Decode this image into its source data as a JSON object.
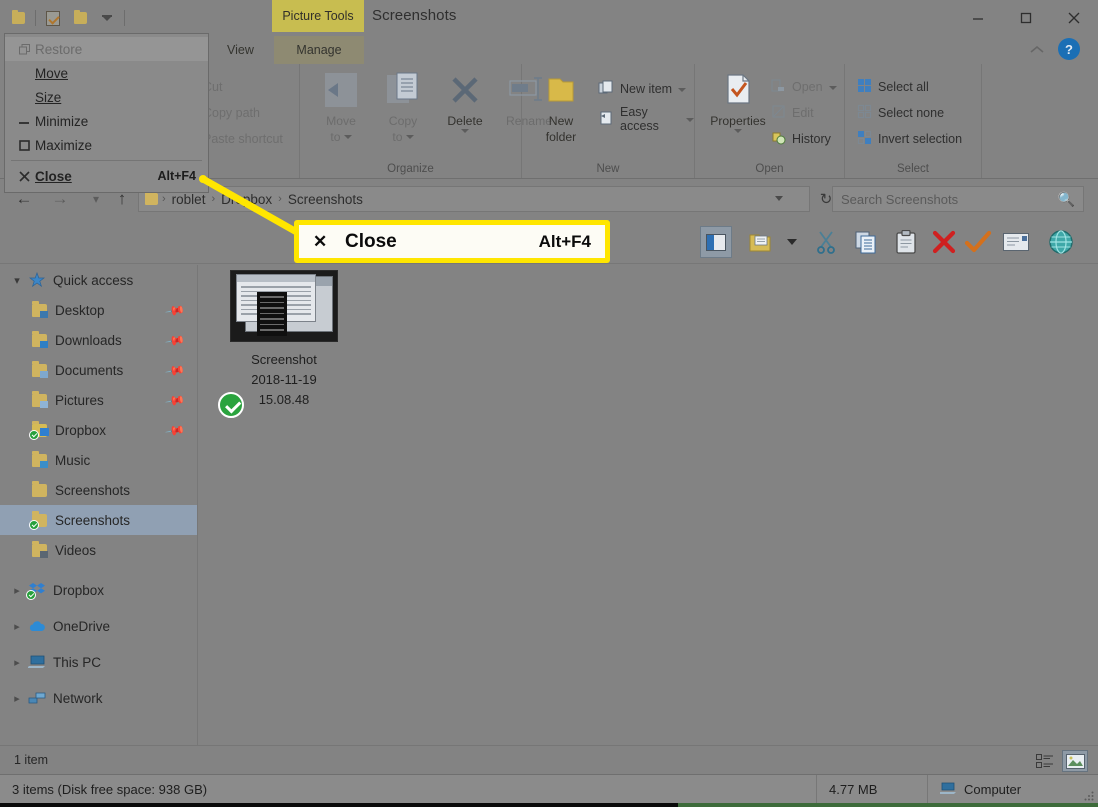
{
  "window": {
    "title": "Screenshots",
    "contextual_tab_group": "Picture Tools",
    "minimize_label": "Minimize",
    "maximize_label": "Maximize",
    "close_label": "Close",
    "help_label": "?",
    "collapse_ribbon_label": "^"
  },
  "quick_access_toolbar": {
    "items": [
      {
        "name": "folder-icon",
        "label": "Properties"
      },
      {
        "name": "properties-icon",
        "label": "Properties"
      },
      {
        "name": "new-folder-icon",
        "label": "New folder"
      },
      {
        "name": "customize-caret-icon",
        "label": "Customize Quick Access Toolbar"
      }
    ]
  },
  "system_menu": {
    "items": [
      {
        "icon": "restore-icon",
        "label": "Restore",
        "accel_index": 0,
        "shortcut": "",
        "disabled": true,
        "highlighted": true,
        "bold": false
      },
      {
        "icon": "",
        "label": "Move",
        "accel_index": 0,
        "shortcut": "",
        "disabled": false,
        "highlighted": false,
        "bold": false
      },
      {
        "icon": "",
        "label": "Size",
        "accel_index": 0,
        "shortcut": "",
        "disabled": false,
        "highlighted": false,
        "bold": false
      },
      {
        "icon": "minimize-icon",
        "label": "Minimize",
        "accel_index": 2,
        "shortcut": "",
        "disabled": false,
        "highlighted": false,
        "bold": false
      },
      {
        "icon": "maximize-icon",
        "label": "Maximize",
        "accel_index": 2,
        "shortcut": "",
        "disabled": false,
        "highlighted": false,
        "bold": false
      },
      {
        "icon": "close-x-icon",
        "label": "Close",
        "accel_index": 0,
        "shortcut": "Alt+F4",
        "disabled": false,
        "highlighted": false,
        "bold": true
      }
    ]
  },
  "ribbon": {
    "tabs": [
      {
        "label": "View",
        "active": false
      },
      {
        "label": "Manage",
        "active": true
      }
    ],
    "groups": [
      {
        "name": "clipboard",
        "label": "",
        "small_commands": [
          "Cut",
          "Copy path",
          "Paste shortcut"
        ]
      },
      {
        "name": "organize",
        "label": "Organize",
        "buttons": [
          {
            "label": "Move\nto",
            "label_line1": "Move",
            "label_line2": "to",
            "has_caret": true,
            "enabled": false,
            "icon": "move-to-icon"
          },
          {
            "label": "Copy\nto",
            "label_line1": "Copy",
            "label_line2": "to",
            "has_caret": true,
            "enabled": false,
            "icon": "copy-to-icon"
          },
          {
            "label": "Delete",
            "label_line1": "Delete",
            "label_line2": "",
            "has_caret": true,
            "enabled": true,
            "icon": "delete-icon"
          },
          {
            "label": "Rename",
            "label_line1": "Rename",
            "label_line2": "",
            "has_caret": false,
            "enabled": false,
            "icon": "rename-icon"
          }
        ]
      },
      {
        "name": "new",
        "label": "New",
        "buttons": [
          {
            "label_line1": "New",
            "label_line2": "folder",
            "has_caret": false,
            "enabled": true,
            "icon": "new-folder-icon"
          }
        ],
        "medium_commands": [
          {
            "label": "New item",
            "icon": "new-item-icon",
            "has_caret": true
          },
          {
            "label": "Easy access",
            "icon": "easy-access-icon",
            "has_caret": true
          }
        ]
      },
      {
        "name": "open",
        "label": "Open",
        "buttons": [
          {
            "label_line1": "Properties",
            "label_line2": "",
            "has_caret": true,
            "enabled": true,
            "icon": "properties-icon"
          }
        ],
        "medium_commands": [
          {
            "label": "Open",
            "icon": "open-icon",
            "has_caret": true,
            "dim": true
          },
          {
            "label": "Edit",
            "icon": "edit-icon",
            "has_caret": false,
            "dim": true
          },
          {
            "label": "History",
            "icon": "history-icon",
            "has_caret": false,
            "dim": false
          }
        ]
      },
      {
        "name": "select",
        "label": "Select",
        "medium_commands": [
          {
            "label": "Select all",
            "icon": "select-all-icon",
            "has_caret": false,
            "dim": false
          },
          {
            "label": "Select none",
            "icon": "select-none-icon",
            "has_caret": false,
            "dim": false
          },
          {
            "label": "Invert selection",
            "icon": "invert-selection-icon",
            "has_caret": false,
            "dim": false
          }
        ]
      }
    ]
  },
  "address_bar": {
    "back_label": "Back",
    "forward_label": "Forward",
    "recent_label": "Recent locations",
    "up_label": "Up",
    "breadcrumbs": [
      "roblet",
      "Dropbox",
      "Screenshots"
    ],
    "refresh_label": "Refresh",
    "separator": "›"
  },
  "search": {
    "placeholder": "Search Screenshots",
    "value": "",
    "icon": "search-icon"
  },
  "toolbar2": {
    "items": [
      {
        "name": "navigation-pane-toggle-icon",
        "label": "Navigation pane",
        "selected": true
      },
      {
        "name": "folder-options-icon",
        "label": "Folder options",
        "selected": false
      },
      {
        "name": "toolbar-dropdown-caret-icon",
        "label": "More",
        "selected": false
      },
      {
        "name": "cut-scissors-icon",
        "label": "Cut",
        "selected": false
      },
      {
        "name": "copy-icon",
        "label": "Copy",
        "selected": false
      },
      {
        "name": "paste-clipboard-icon",
        "label": "Paste",
        "selected": false
      },
      {
        "name": "delete-red-x-icon",
        "label": "Delete",
        "selected": false
      },
      {
        "name": "confirm-orange-check-icon",
        "label": "Properties",
        "selected": false
      },
      {
        "name": "email-icon",
        "label": "Email",
        "selected": false
      },
      {
        "name": "internet-globe-icon",
        "label": "Internet",
        "selected": false
      }
    ]
  },
  "nav_pane": {
    "items": [
      {
        "label": "Quick access",
        "icon": "quick-access-star-icon",
        "chevron": "open",
        "indent": 0,
        "pinned": false,
        "selected": false,
        "sync": false
      },
      {
        "label": "Desktop",
        "icon": "desktop-folder-icon",
        "chevron": "",
        "indent": 1,
        "pinned": true,
        "selected": false,
        "sync": false
      },
      {
        "label": "Downloads",
        "icon": "downloads-folder-icon",
        "chevron": "",
        "indent": 1,
        "pinned": true,
        "selected": false,
        "sync": false
      },
      {
        "label": "Documents",
        "icon": "documents-folder-icon",
        "chevron": "",
        "indent": 1,
        "pinned": true,
        "selected": false,
        "sync": false
      },
      {
        "label": "Pictures",
        "icon": "pictures-folder-icon",
        "chevron": "",
        "indent": 1,
        "pinned": true,
        "selected": false,
        "sync": false
      },
      {
        "label": "Dropbox",
        "icon": "dropbox-folder-icon",
        "chevron": "",
        "indent": 1,
        "pinned": true,
        "selected": false,
        "sync": true
      },
      {
        "label": "Music",
        "icon": "music-folder-icon",
        "chevron": "",
        "indent": 1,
        "pinned": false,
        "selected": false,
        "sync": false
      },
      {
        "label": "Screenshots",
        "icon": "folder-icon",
        "chevron": "",
        "indent": 1,
        "pinned": false,
        "selected": false,
        "sync": false
      },
      {
        "label": "Screenshots",
        "icon": "folder-icon",
        "chevron": "",
        "indent": 1,
        "pinned": false,
        "selected": true,
        "sync": true
      },
      {
        "label": "Videos",
        "icon": "videos-folder-icon",
        "chevron": "",
        "indent": 1,
        "pinned": false,
        "selected": false,
        "sync": false
      },
      {
        "label": "Dropbox",
        "icon": "dropbox-icon",
        "chevron": "closed",
        "indent": 0,
        "pinned": false,
        "selected": false,
        "sync": true
      },
      {
        "label": "OneDrive",
        "icon": "onedrive-cloud-icon",
        "chevron": "closed",
        "indent": 0,
        "pinned": false,
        "selected": false,
        "sync": false
      },
      {
        "label": "This PC",
        "icon": "this-pc-icon",
        "chevron": "closed",
        "indent": 0,
        "pinned": false,
        "selected": false,
        "sync": false
      },
      {
        "label": "Network",
        "icon": "network-icon",
        "chevron": "closed",
        "indent": 0,
        "pinned": false,
        "selected": false,
        "sync": false
      }
    ]
  },
  "files": [
    {
      "name_lines": [
        "Screenshot",
        "2018-11-19",
        "15.08.48"
      ],
      "full_name": "Screenshot 2018-11-19 15.08.48",
      "sync_badge": "green-check-icon"
    }
  ],
  "status_bar_inner": {
    "item_count": "1 item",
    "view_buttons": [
      {
        "name": "details-view-icon",
        "label": "Details view",
        "selected": false
      },
      {
        "name": "large-icons-view-icon",
        "label": "Large icons view",
        "selected": true
      }
    ]
  },
  "status_bar_outer": {
    "items_text": "3 items (Disk free space: 938 GB)",
    "size_text": "4.77 MB",
    "location_text": "Computer",
    "location_icon": "computer-icon"
  },
  "callout": {
    "x_icon": "close-x-icon",
    "label": "Close",
    "shortcut": "Alt+F4",
    "border_color": "#ffe600",
    "fill_color": "#fdfcf5",
    "arrow_color": "#ffe600"
  },
  "colors": {
    "window_bg": "#838383",
    "contextual_tab": "#c8bd50",
    "selection": "#90a0b3",
    "highlight_yellow": "#ffe600",
    "sync_green": "#2aa33e",
    "help_blue": "#1b6fb5"
  }
}
